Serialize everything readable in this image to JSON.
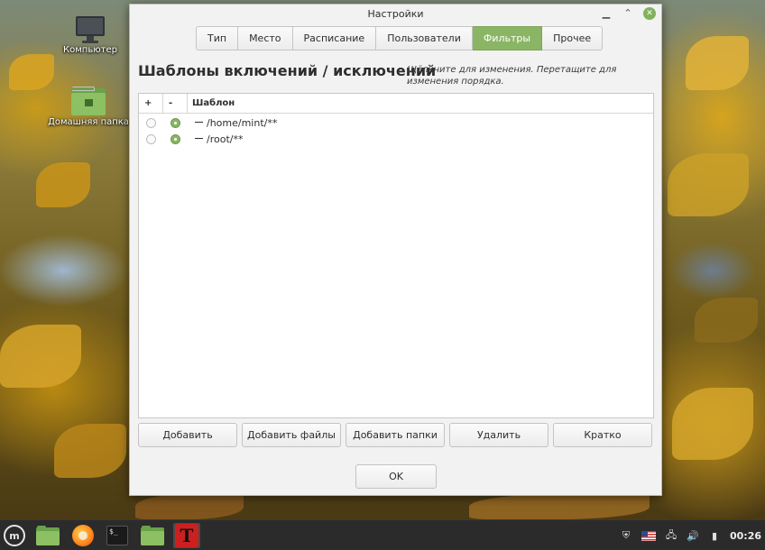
{
  "desktop": {
    "icons": [
      {
        "label": "Компьютер",
        "icon": "computer-icon"
      },
      {
        "label": "Домашняя папка",
        "icon": "home-folder-icon"
      }
    ]
  },
  "window": {
    "title": "Настройки",
    "controls": {
      "minimize": "▁",
      "maximize": "⌃",
      "close": "✕"
    }
  },
  "tabs": [
    {
      "label": "Тип",
      "active": false
    },
    {
      "label": "Место",
      "active": false
    },
    {
      "label": "Расписание",
      "active": false
    },
    {
      "label": "Пользователи",
      "active": false
    },
    {
      "label": "Фильтры",
      "active": true
    },
    {
      "label": "Прочее",
      "active": false
    }
  ],
  "main": {
    "heading": "Шаблоны включений / исключений",
    "hint": "Щёлкните для изменения. Перетащите для изменения порядка.",
    "list": {
      "columns": {
        "include": "+",
        "exclude": "-",
        "pattern": "Шаблон"
      },
      "rows": [
        {
          "include": false,
          "exclude": true,
          "pattern": "/home/mint/**"
        },
        {
          "include": false,
          "exclude": true,
          "pattern": "/root/**"
        }
      ]
    },
    "buttons": {
      "add": "Добавить",
      "add_files": "Добавить файлы",
      "add_folders": "Добавить папки",
      "remove": "Удалить",
      "summary": "Кратко"
    },
    "ok": "OK"
  },
  "taskbar": {
    "menu": "m",
    "terminal_prompt": "$_",
    "timeshift": "T",
    "tray": {
      "shield": "⛨",
      "network": "🖧",
      "volume": "🔊",
      "battery": "▮"
    },
    "clock": "00:26"
  },
  "colors": {
    "accent": "#8ab565",
    "taskbar": "#2b2b2b",
    "dialog_bg": "#f2f2f2"
  }
}
